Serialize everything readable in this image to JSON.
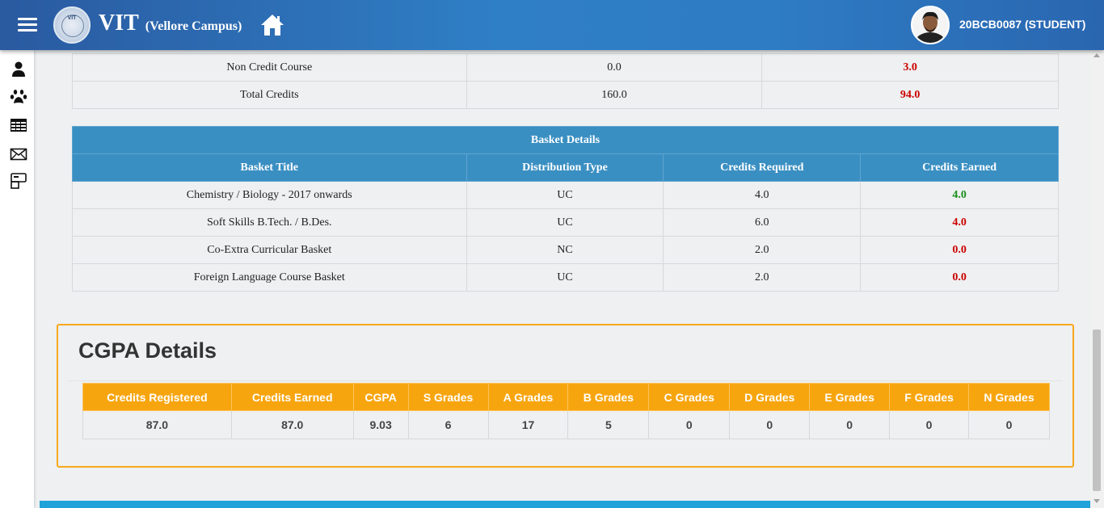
{
  "header": {
    "brand_main": "VIT",
    "brand_sub": "(Vellore Campus)",
    "logo_text": "VIT",
    "user_label": "20BCB0087 (STUDENT)"
  },
  "sidebar": {
    "icons": [
      "user-icon",
      "paw-icon",
      "table-icon",
      "mail-icon",
      "card-icon"
    ]
  },
  "credits_table": {
    "rows": [
      {
        "label": "Non Credit Course",
        "required": "0.0",
        "earned": "3.0"
      },
      {
        "label": "Total Credits",
        "required": "160.0",
        "earned": "94.0"
      }
    ]
  },
  "basket": {
    "title": "Basket Details",
    "headers": [
      "Basket Title",
      "Distribution Type",
      "Credits Required",
      "Credits Earned"
    ],
    "rows": [
      {
        "title": "Chemistry / Biology - 2017 onwards",
        "type": "UC",
        "required": "4.0",
        "earned": "4.0",
        "status": "complete"
      },
      {
        "title": "Soft Skills B.Tech. / B.Des.",
        "type": "UC",
        "required": "6.0",
        "earned": "4.0",
        "status": "incomplete"
      },
      {
        "title": "Co-Extra Curricular Basket",
        "type": "NC",
        "required": "2.0",
        "earned": "0.0",
        "status": "incomplete"
      },
      {
        "title": "Foreign Language Course Basket",
        "type": "UC",
        "required": "2.0",
        "earned": "0.0",
        "status": "incomplete"
      }
    ]
  },
  "cgpa": {
    "title": "CGPA Details",
    "headers": [
      "Credits Registered",
      "Credits Earned",
      "CGPA",
      "S Grades",
      "A Grades",
      "B Grades",
      "C Grades",
      "D Grades",
      "E Grades",
      "F Grades",
      "N Grades"
    ],
    "values": [
      "87.0",
      "87.0",
      "9.03",
      "6",
      "17",
      "5",
      "0",
      "0",
      "0",
      "0",
      "0"
    ]
  },
  "colors": {
    "header_blue": "#2f7fc6",
    "table_head_blue": "#3a8fc2",
    "cgpa_orange": "#f7a50f",
    "earned_red": "#cc0000",
    "earned_green": "#1a8f1a"
  }
}
